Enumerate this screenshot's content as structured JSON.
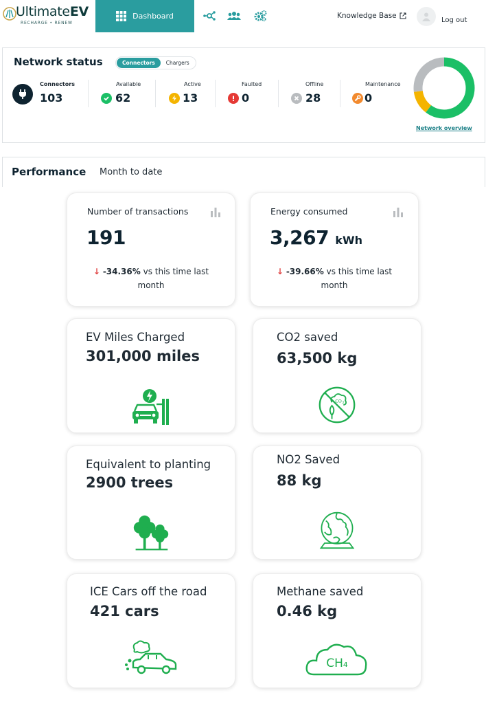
{
  "brand": {
    "name_prefix": "Ultimate",
    "name_suffix": "EV",
    "tagline": "RECHARGE • RENEW",
    "colors": {
      "primary": "#2a9d9f",
      "dark": "#0e2330",
      "green": "#1bbf66",
      "amber": "#f4b400",
      "red": "#e53935",
      "gray": "#b9bcbf",
      "orange": "#f28a2e"
    }
  },
  "nav": {
    "dashboard_label": "Dashboard",
    "icons": [
      "network-icon",
      "users-icon",
      "settings-gears-icon"
    ],
    "knowledge_base_label": "Knowledge Base",
    "logout_label": "Log out"
  },
  "network_status": {
    "title": "Network status",
    "toggle": {
      "options": [
        "Connectors",
        "Chargers"
      ],
      "selected": "Connectors"
    },
    "stats": [
      {
        "key": "connectors",
        "label": "Connectors",
        "value": "103",
        "icon": "plug-icon",
        "color": "#0e2330"
      },
      {
        "key": "available",
        "label": "Available",
        "value": "62",
        "icon": "check-icon",
        "color": "#1bbf66"
      },
      {
        "key": "active",
        "label": "Active",
        "value": "13",
        "icon": "lightning-icon",
        "color": "#f4b400"
      },
      {
        "key": "faulted",
        "label": "Faulted",
        "value": "0",
        "icon": "exclamation-icon",
        "color": "#e53935"
      },
      {
        "key": "offline",
        "label": "Offline",
        "value": "28",
        "icon": "x-icon",
        "color": "#b9bcbf"
      },
      {
        "key": "maintenance",
        "label": "Maintenance",
        "value": "0",
        "icon": "wrench-icon",
        "color": "#f28a2e"
      }
    ],
    "donut": {
      "available": 62,
      "active": 13,
      "offline": 28
    },
    "link_label": "Network overview"
  },
  "performance": {
    "title": "Performance",
    "period": "Month to date",
    "transactions": {
      "label": "Number of transactions",
      "value": "191",
      "delta_pct": "-34.36%",
      "delta_text_1": "vs this time last",
      "delta_text_2": "month"
    },
    "energy": {
      "label": "Energy consumed",
      "value": "3,267",
      "unit": "kWh",
      "delta_pct": "-39.66%",
      "delta_text_1": "vs this time last",
      "delta_text_2": "month"
    },
    "impact": [
      {
        "key": "miles",
        "label": "EV Miles Charged",
        "value": "301,000 miles",
        "icon": "ev-charging-car-icon"
      },
      {
        "key": "co2",
        "label": "CO2 saved",
        "value": "63,500 kg",
        "icon": "no-co2-icon"
      },
      {
        "key": "trees",
        "label": "Equivalent to planting",
        "value": "2900 trees",
        "icon": "trees-icon"
      },
      {
        "key": "no2",
        "label": "NO2 Saved",
        "value": "88 kg",
        "icon": "globe-icon"
      },
      {
        "key": "cars",
        "label": "ICE Cars off the road",
        "value": "421 cars",
        "icon": "exhaust-car-icon"
      },
      {
        "key": "methane",
        "label": "Methane saved",
        "value": "0.46 kg",
        "icon": "ch4-cloud-icon",
        "icon_text": "CH₄"
      }
    ]
  }
}
